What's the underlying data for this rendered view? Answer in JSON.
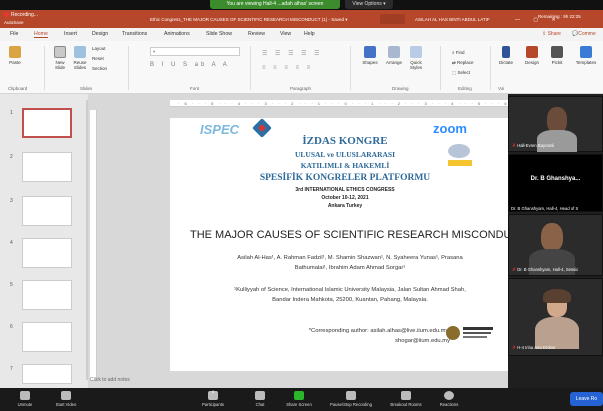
{
  "zoom": {
    "viewing_banner": "You are viewing Hall-4 ...adah alhas' screen",
    "view_options": "View Options ▾",
    "remaining": "Remaining : 9h 22:25",
    "recording": "Recording...",
    "toolbar": [
      {
        "label": "Unmute",
        "icon": "mic-off-icon"
      },
      {
        "label": "Start Video",
        "icon": "video-off-icon"
      },
      {
        "label": "Participants",
        "icon": "participants-icon"
      },
      {
        "label": "Chat",
        "icon": "chat-icon"
      },
      {
        "label": "Share Screen",
        "icon": "share-screen-icon"
      },
      {
        "label": "Pause/Stop Recording",
        "icon": "pause-icon"
      },
      {
        "label": "Breakout Rooms",
        "icon": "breakout-icon"
      },
      {
        "label": "Reactions",
        "icon": "reactions-icon"
      }
    ],
    "participants_count": "8",
    "leave": "Leave Ro",
    "participants": [
      {
        "name": "Hall-Evren Bayramli",
        "muted": true
      },
      {
        "name": "Dr. B Ghanshya...",
        "muted": false
      },
      {
        "name": "Dr. B Ghanshyam, Hall-4, Head of S",
        "muted": false
      },
      {
        "name": "Dr. B Ghanshyam, Hall-4, Sessio",
        "muted": true
      },
      {
        "name": "H-4 Irina Ana Drobot",
        "muted": true
      }
    ]
  },
  "ppt": {
    "autosave": "AutoSave",
    "title": "Ethic Congress_THE MAJOR CAUSES OF SCIENTIFIC RESEARCH MISCONDUCT (1) - Saved ▾",
    "user": "ASILAH AL HAS BINTI ABDUL LATIF",
    "tabs": [
      "File",
      "Home",
      "Insert",
      "Design",
      "Transitions",
      "Animations",
      "Slide Show",
      "Review",
      "View",
      "Help"
    ],
    "active_tab": "Home",
    "share": "Share",
    "comments": "Comme",
    "groups": {
      "clipboard": "Clipboard",
      "slides": "Slides",
      "font": "Font",
      "paragraph": "Paragraph",
      "drawing": "Drawing",
      "editing": "Editing",
      "voice": "Voi"
    },
    "buttons": {
      "paste": "Paste",
      "new_slide": "New Slide",
      "reuse_slides": "Reuse Slides",
      "layout": "Layout",
      "reset": "Reset",
      "section": "Section",
      "shapes": "Shapes",
      "arrange": "Arrange",
      "quick_styles": "Quick Styles",
      "find": "Find",
      "replace": "Replace",
      "select": "Select",
      "dictate": "Dictate",
      "designer": "Design",
      "pickit": "Pickit",
      "templates": "Templates"
    },
    "thumbnail_numbers": [
      "1",
      "2",
      "3",
      "4",
      "5",
      "6",
      "7"
    ],
    "notes_placeholder": "Click to add notes"
  },
  "slide": {
    "ispec": "ISPEC",
    "zoom_logo": "zoom",
    "line1": "İZDAS KONGRE",
    "line2": "ULUSAL ve ULUSLARARASI",
    "line3": "KATILIMLI & HAKEMLİ",
    "line4": "SPESİFİK KONGRELER PLATFORMU",
    "line5": "3rd INTERNATIONAL ETHICS CONGRESS",
    "line6": "October 10-12, 2021",
    "line7": "Ankara Turkey",
    "title": "THE MAJOR CAUSES OF SCIENTIFIC RESEARCH MISCONDU",
    "authors_line1": "Asilah Al-Has¹, A. Rahman Fadzil¹, M. Shamin Shazwan¹, N. Syaheera Yunas¹, Prasana",
    "authors_line2": "Bathumalai¹, Ibrahim Adam Ahmad Sorgar¹",
    "affil_line1": "¹Kulliyyah of Science, International Islamic University Malaysia, Jalan Sultan Ahmad Shah,",
    "affil_line2": "Bandar Indera Mahkota, 25200, Kuantan, Pahang, Malaysia.",
    "corr_line1": "*Corresponding author: asilah.alhas@live.iium.edu.my;",
    "corr_line2": "shogar@iium.edu.my"
  }
}
